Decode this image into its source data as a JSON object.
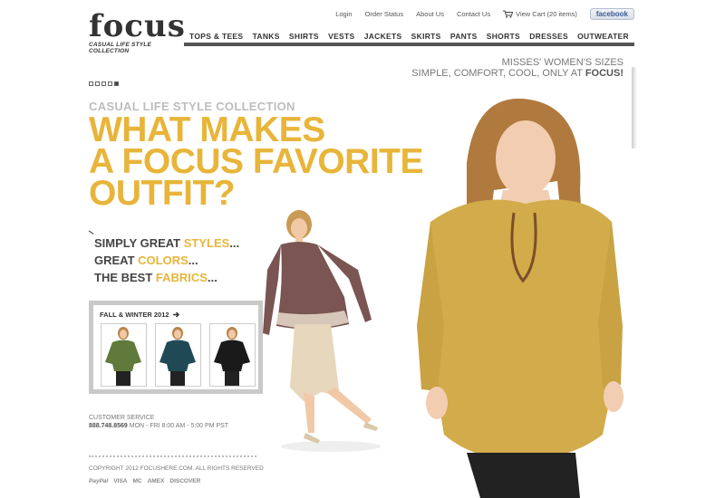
{
  "brand": {
    "name": "focus",
    "tagline": "CASUAL LIFE STYLE COLLECTION"
  },
  "util_nav": {
    "login": "Login",
    "order_status": "Order Status",
    "about": "About Us",
    "contact": "Contact Us",
    "cart": "View Cart (20 items)",
    "facebook": "facebook"
  },
  "main_nav": [
    "TOPS & TEES",
    "TANKS",
    "SHIRTS",
    "VESTS",
    "JACKETS",
    "SKIRTS",
    "PANTS",
    "SHORTS",
    "DRESSES",
    "OUTWEATER"
  ],
  "promo": {
    "line1": "MISSES' WOMEN'S SIZES",
    "line2_prefix": "SIMPLE, COMFORT, COOL, ONLY AT ",
    "line2_brand": "FOCUS!"
  },
  "slider": {
    "count": 5,
    "active": 5
  },
  "hero": {
    "kicker": "CASUAL LIFE STYLE COLLECTION",
    "headline": [
      "WHAT MAKES",
      "A FOCUS FAVORITE",
      "OUTFIT?"
    ],
    "sub": [
      {
        "pre": "SIMPLY GREAT ",
        "hl": "STYLES",
        "post": "..."
      },
      {
        "pre": "GREAT ",
        "hl": "COLORS",
        "post": "..."
      },
      {
        "pre": "THE BEST ",
        "hl": "FABRICS",
        "post": "..."
      }
    ]
  },
  "collection_box": {
    "title": "FALL & WINTER 2012",
    "thumbs": [
      {
        "top_color": "#5f7a3a"
      },
      {
        "top_color": "#1f4a55"
      },
      {
        "top_color": "#1a1a1a"
      }
    ]
  },
  "footer": {
    "cs_label": "CUSTOMER SERVICE",
    "phone": "888.748.8569",
    "hours": " MON - FRI 8:00 AM - 5:00 PM PST",
    "copyright": "COPYRIGHT 2012 FOCUSHERE.COM. ALL RIGHTS RESERVED",
    "payments": [
      "PayPal",
      "VISA",
      "MC",
      "AMEX",
      "DISCOVER"
    ]
  },
  "colors": {
    "accent": "#e8b53a",
    "nav_bar": "#555555"
  }
}
